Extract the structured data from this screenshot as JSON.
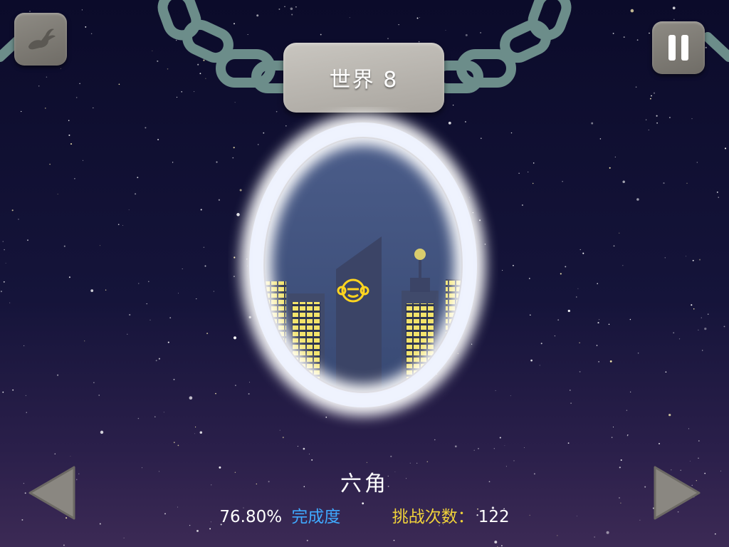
{
  "world": {
    "label": "世界 8"
  },
  "level": {
    "name": "六角",
    "completion_value": "76.80%",
    "completion_label": "完成度",
    "attempts_label": "挑战次数：",
    "attempts_value": "122"
  },
  "controls": {
    "speed_icon": "rabbit-icon",
    "pause_icon": "pause-icon",
    "prev_icon": "triangle-left-icon",
    "next_icon": "triangle-right-icon"
  },
  "colors": {
    "completion_label": "#3fa9ff",
    "attempts_label": "#f0d23a",
    "window_lights": "#f3e36a",
    "monkey_logo": "#ffd51f"
  }
}
